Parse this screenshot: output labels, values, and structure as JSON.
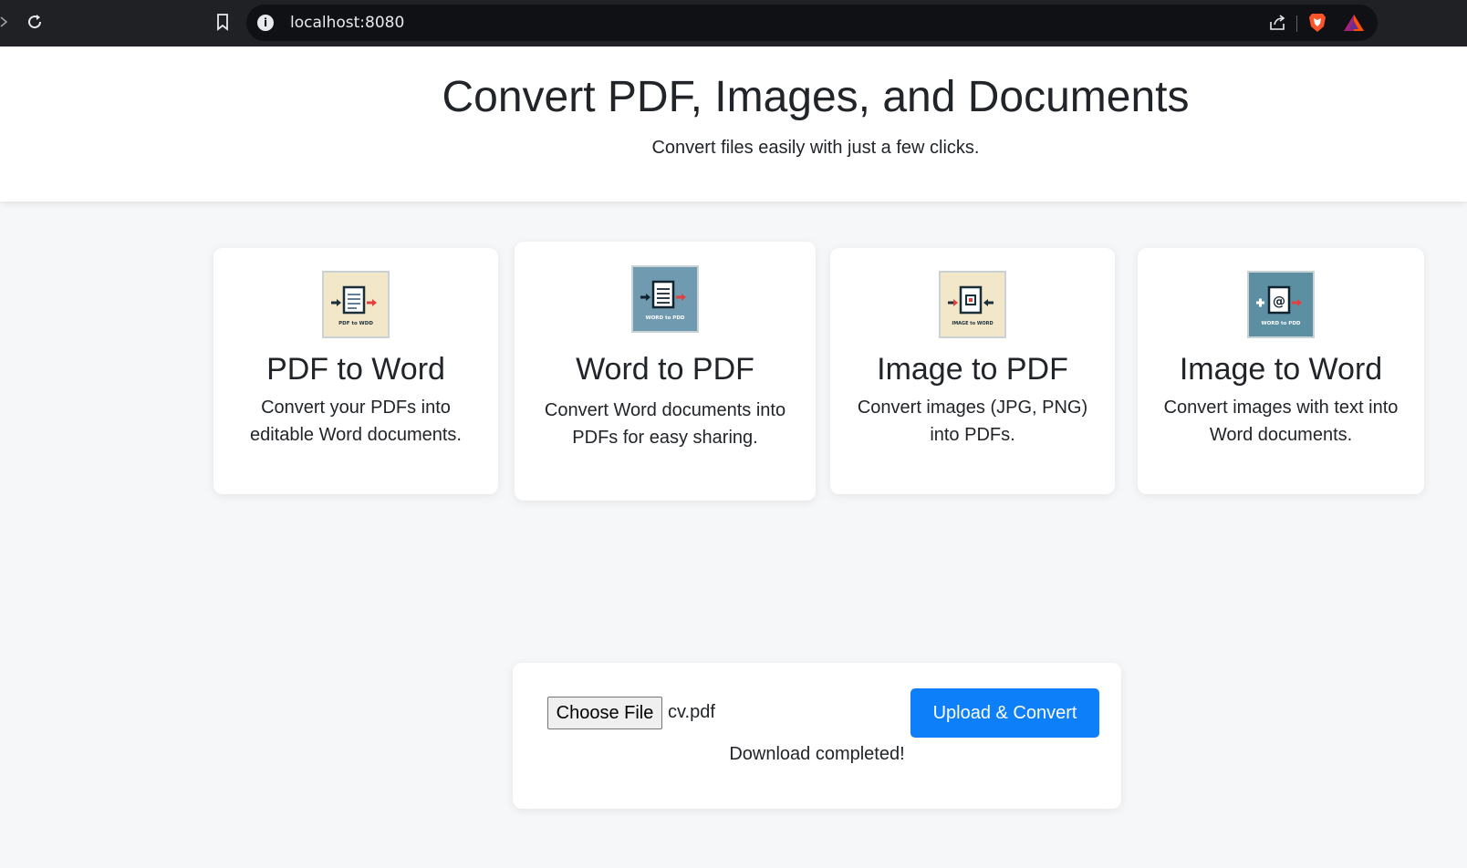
{
  "browser": {
    "url": "localhost:8080",
    "icons": [
      "forward-arrow-icon",
      "reload-icon",
      "bookmark-icon",
      "info-icon",
      "share-icon",
      "brave-shield-icon",
      "bat-rewards-icon"
    ]
  },
  "header": {
    "title": "Convert PDF, Images, and Documents",
    "subtitle": "Convert files easily with just a few clicks."
  },
  "cards": [
    {
      "title": "PDF to Word",
      "description": "Convert your PDFs into editable Word documents.",
      "icon_label": "PDF to WDD",
      "icon_bg": "#f3e7c9"
    },
    {
      "title": "Word to PDF",
      "description": "Convert Word documents into PDFs for easy sharing.",
      "icon_label": "WORD to PDD",
      "icon_bg": "#6f9ab0"
    },
    {
      "title": "Image to PDF",
      "description": "Convert images (JPG, PNG) into PDFs.",
      "icon_label": "IMAGE to WORD",
      "icon_bg": "#f3e7c9"
    },
    {
      "title": "Image to Word",
      "description": "Convert images with text into Word documents.",
      "icon_label": "WORD to PDD",
      "icon_bg": "#5d8fa3"
    }
  ],
  "upload": {
    "choose_label": "Choose File",
    "file_name": "cv.pdf",
    "convert_label": "Upload & Convert",
    "status": "Download completed!"
  },
  "colors": {
    "primary": "#0d7ff9",
    "page_bg": "#f6f7f9",
    "chrome_bg": "#202124"
  }
}
